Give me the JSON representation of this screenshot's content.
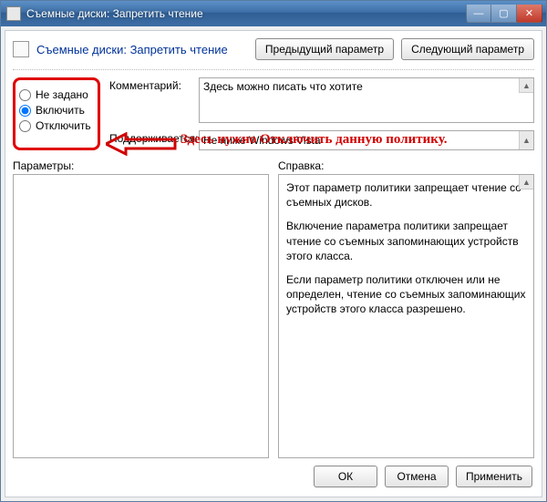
{
  "window": {
    "title": "Съемные диски: Запретить чтение"
  },
  "header": {
    "title": "Съемные диски: Запретить чтение",
    "prev_btn": "Предыдущий параметр",
    "next_btn": "Следующий параметр"
  },
  "radios": {
    "not_configured": "Не задано",
    "enabled": "Включить",
    "disabled": "Отключить"
  },
  "comment": {
    "label": "Комментарий:",
    "value": "Здесь можно писать что хотите"
  },
  "support": {
    "label": "Поддерживается:",
    "value": "Не ниже Windows Vista"
  },
  "annotation": "Здесь нужно Отключить данную политику.",
  "params": {
    "title": "Параметры:"
  },
  "help": {
    "title": "Справка:",
    "p1": "Этот параметр политики запрещает чтение со съемных дисков.",
    "p2": "Включение параметра политики запрещает чтение со съемных запоминающих устройств этого класса.",
    "p3": "Если параметр политики отключен или не определен, чтение со съемных запоминающих устройств этого класса разрешено."
  },
  "footer": {
    "ok": "ОК",
    "cancel": "Отмена",
    "apply": "Применить"
  }
}
